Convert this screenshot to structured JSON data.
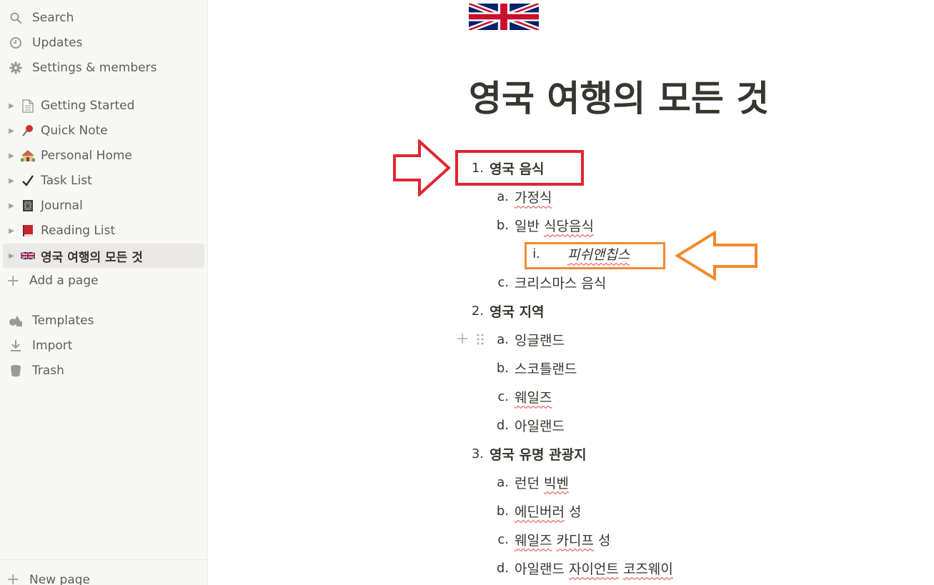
{
  "sidebar": {
    "top_items": [
      {
        "label": "Search",
        "icon": "search-icon"
      },
      {
        "label": "Updates",
        "icon": "clock-icon"
      },
      {
        "label": "Settings & members",
        "icon": "gear-icon"
      }
    ],
    "pages": [
      {
        "label": "Getting Started",
        "icon": "document-icon",
        "glyph": "🗋"
      },
      {
        "label": "Quick Note",
        "icon": "pushpin-icon",
        "glyph": "📌"
      },
      {
        "label": "Personal Home",
        "icon": "house-icon",
        "glyph": "🏡"
      },
      {
        "label": "Task List",
        "icon": "checkmark-icon",
        "glyph": "✔"
      },
      {
        "label": "Journal",
        "icon": "notebook-icon",
        "glyph": "📓"
      },
      {
        "label": "Reading List",
        "icon": "book-icon",
        "glyph": "📕"
      },
      {
        "label": "영국 여행의 모든 것",
        "icon": "uk-flag-icon",
        "glyph": "🇬🇧"
      }
    ],
    "add_page": "Add a page",
    "bottom_items": [
      {
        "label": "Templates",
        "icon": "templates-icon"
      },
      {
        "label": "Import",
        "icon": "import-icon"
      },
      {
        "label": "Trash",
        "icon": "trash-icon"
      }
    ],
    "new_page": "New page"
  },
  "page": {
    "cover_icon": "uk-flag-icon",
    "title": "영국 여행의 모든 것",
    "list": [
      {
        "marker": "1.",
        "text": "영국 음식",
        "level": 1
      },
      {
        "marker": "a.",
        "text": "가정식",
        "level": 2
      },
      {
        "marker": "b.",
        "text_a": "일반 ",
        "text_b": "식당음식",
        "level": 2
      },
      {
        "marker": "i.",
        "text": "피쉬앤칩스",
        "level": 3
      },
      {
        "marker": "c.",
        "text": "크리스마스 음식",
        "level": 2
      },
      {
        "marker": "2.",
        "text": "영국 지역",
        "level": 1
      },
      {
        "marker": "a.",
        "text": "잉글랜드",
        "level": 2
      },
      {
        "marker": "b.",
        "text": "스코틀랜드",
        "level": 2
      },
      {
        "marker": "c.",
        "text": "웨일즈",
        "level": 2
      },
      {
        "marker": "d.",
        "text": "아일랜드",
        "level": 2
      },
      {
        "marker": "3.",
        "text": "영국 유명 관광지",
        "level": 1
      },
      {
        "marker": "a.",
        "text_a": "런던 ",
        "text_b": "빅벤",
        "level": 2
      },
      {
        "marker": "b.",
        "text_a": "에딘버러",
        "text_b": " 성",
        "level": 2
      },
      {
        "marker": "c.",
        "text_a": "웨일즈",
        "text_mid": " ",
        "text_b": "카디프",
        "text_c": " 성",
        "level": 2
      },
      {
        "marker": "d.",
        "text_a": "아일랜드 ",
        "text_b": "자이언트",
        "text_mid": " ",
        "text_c": "코즈웨이",
        "level": 2
      }
    ]
  },
  "colors": {
    "highlight_red": "#e0262e",
    "highlight_orange": "#f28a2e",
    "sidebar_bg": "#f7f7f5"
  }
}
